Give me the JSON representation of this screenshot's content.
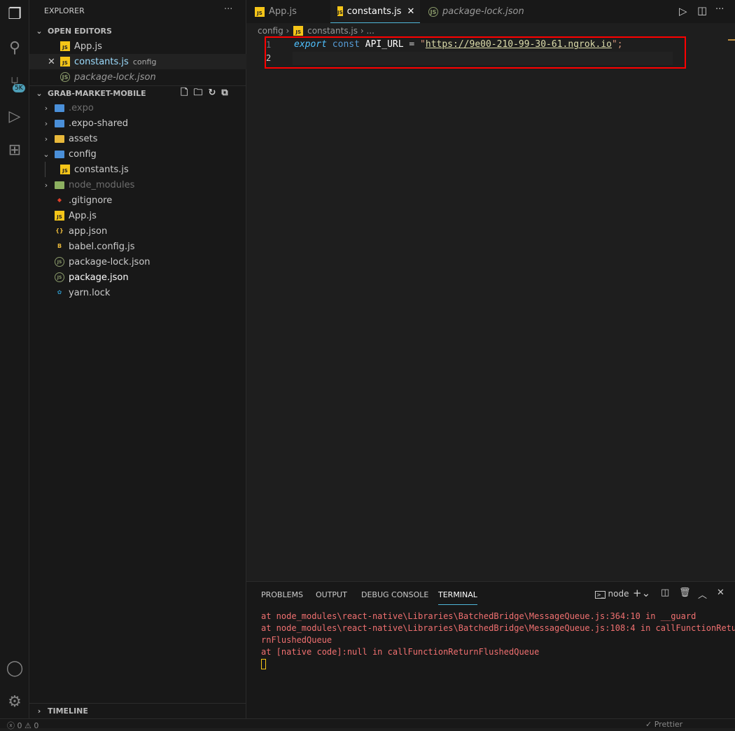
{
  "sidebar": {
    "title": "EXPLORER",
    "more": "···",
    "open_editors_label": "OPEN EDITORS",
    "open_editors": [
      {
        "name": "App.js",
        "hint": ""
      },
      {
        "name": "constants.js",
        "hint": "config"
      },
      {
        "name": "package-lock.json",
        "hint": ""
      }
    ],
    "project_label": "GRAB-MARKET-MOBILE",
    "tree": [
      ".expo",
      ".expo-shared",
      "assets",
      "config",
      "constants.js",
      "node_modules",
      ".gitignore",
      "App.js",
      "app.json",
      "babel.config.js",
      "package-lock.json",
      "package.json",
      "yarn.lock"
    ],
    "timeline_label": "TIMELINE"
  },
  "activity": {
    "scm_badge": "5K"
  },
  "tabs": [
    "App.js",
    "constants.js",
    "package-lock.json"
  ],
  "breadcrumb": {
    "folder": "config",
    "file": "constants.js",
    "rest": "..."
  },
  "editor": {
    "line_numbers": [
      "1",
      "2"
    ],
    "kw_export": "export",
    "kw_const": "const",
    "ident": "API_URL",
    "op": " = ",
    "quote": "\"",
    "url": "https://9e00-210-99-30-61.ngrok.io",
    "end": "\";"
  },
  "panel": {
    "tabs": [
      "PROBLEMS",
      "OUTPUT",
      "DEBUG CONSOLE",
      "TERMINAL"
    ],
    "terminal_name": "node",
    "lines": [
      "at node_modules\\react-native\\Libraries\\BatchedBridge\\MessageQueue.js:364:10 in __guard",
      "at node_modules\\react-native\\Libraries\\BatchedBridge\\MessageQueue.js:108:4 in callFunctionRetu",
      "rnFlushedQueue",
      "at [native code]:null in callFunctionReturnFlushedQueue"
    ]
  },
  "status": {
    "errors": "0",
    "warnings": "0",
    "prettier": "Prettier"
  }
}
